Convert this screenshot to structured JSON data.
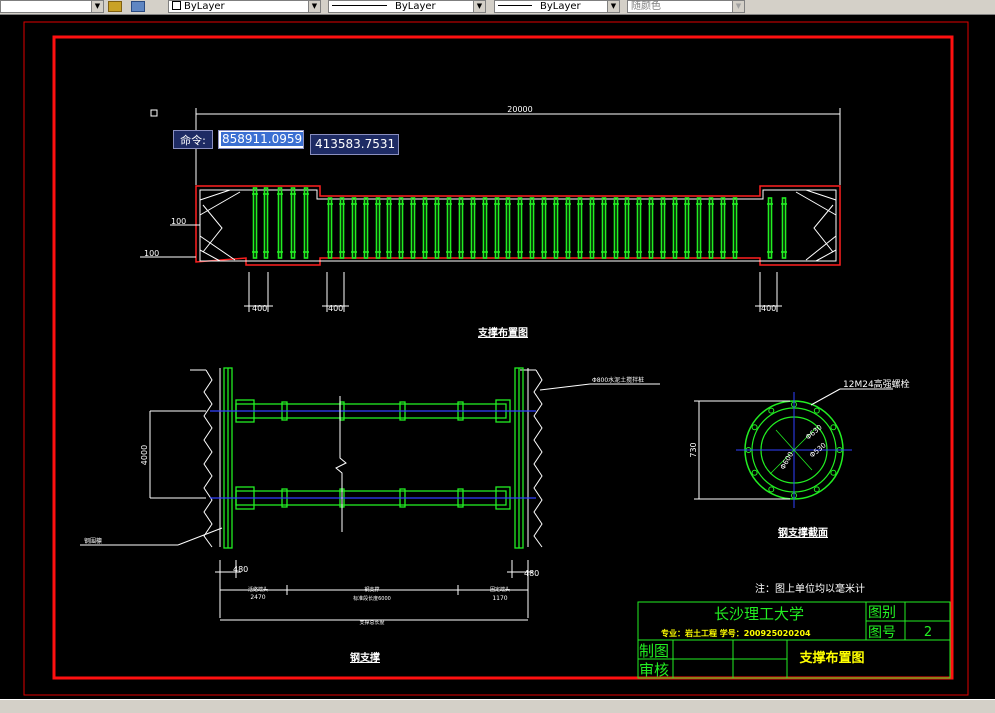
{
  "toolbar": {
    "layer_combo1": "ByLayer",
    "linetype_combo": "ByLayer",
    "lineweight_combo": "ByLayer",
    "color_combo": "随颜色"
  },
  "command": {
    "label": "命令:",
    "x_value": "858911.0959",
    "y_value": "413583.7531"
  },
  "plan": {
    "total_dim": "20000",
    "left_dim_100a": "100",
    "left_dim_100b": "100",
    "dim_400_1": "400",
    "dim_400_2": "400",
    "dim_400_3": "400",
    "title": "支撑布置图"
  },
  "section": {
    "height_dim": "4000",
    "pipe_note": "Φ800水泥土搅拌桩",
    "left_note": "钢围檩",
    "dim_480_left": "480",
    "dim_480_right": "480",
    "bottom_left_label": "活络端头",
    "bottom_left_value": "2470",
    "bottom_mid_label1": "钢支撑",
    "bottom_mid_label2": "标准段长度6000",
    "bottom_right_label": "固定端头",
    "bottom_right_value": "1170",
    "bottom_total_label": "支撑总长度",
    "title": "钢支撑"
  },
  "detail": {
    "bolt_label": "12M24高强螺栓",
    "height_dim": "730",
    "dim_a": "Φ630",
    "dim_b": "Φ530",
    "dim_c": "Φ600",
    "title": "钢支撑截面"
  },
  "note": "注：图上单位均以毫米计",
  "title_block": {
    "school": "长沙理工大学",
    "category_label": "图别",
    "number_label": "图号",
    "number_value": "2",
    "major_line": "专业：岩土工程   学号：200925020204",
    "drawn_label": "制图",
    "review_label": "审核",
    "drawing_title": "支撑布置图"
  }
}
